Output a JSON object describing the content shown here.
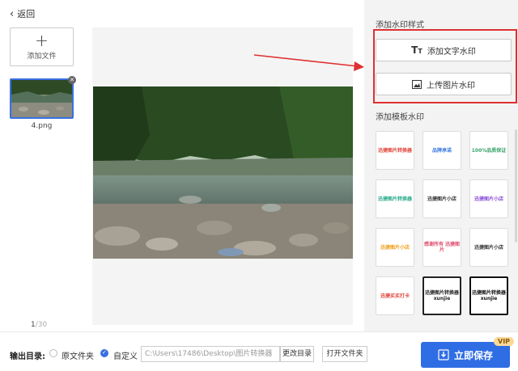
{
  "header": {
    "back_label": "返回"
  },
  "files": {
    "add_label": "添加文件",
    "items": [
      {
        "name": "4.png"
      }
    ],
    "page_current": "1",
    "page_total": "/30"
  },
  "panel": {
    "style_title": "添加水印样式",
    "text_watermark_label": "添加文字水印",
    "image_watermark_label": "上传图片水印",
    "template_title": "添加模板水印",
    "templates": [
      {
        "text": "迅捷图片转换器",
        "color": "#e0443a"
      },
      {
        "text": "品牌承诺",
        "color": "#3a7be0"
      },
      {
        "text": "100%品质保证",
        "color": "#39a36b"
      },
      {
        "text": "迅捷图片转换器",
        "color": "#27a98a"
      },
      {
        "text": "迅捷图片小店",
        "color": "#333333"
      },
      {
        "text": "迅捷图片小店",
        "color": "#8a4fd6"
      },
      {
        "text": "迅捷图片小店",
        "color": "#f0a020"
      },
      {
        "text": "感谢所有 迅捷图片",
        "color": "#e05070"
      },
      {
        "text": "迅捷图片小店",
        "color": "#333333"
      },
      {
        "text": "迅捷买买打卡",
        "color": "#e0443a"
      },
      {
        "text": "迅捷图片转换器 xunjie",
        "color": "#222222"
      },
      {
        "text": "迅捷图片转换器 xunjie",
        "color": "#111111"
      }
    ]
  },
  "output": {
    "label": "输出目录:",
    "option_original": "原文件夹",
    "option_custom": "自定义",
    "path": "C:\\Users\\17486\\Desktop\\图片转换器",
    "change_dir_label": "更改目录",
    "open_folder_label": "打开文件夹",
    "save_label": "立即保存",
    "vip_badge": "VIP"
  },
  "colors": {
    "accent": "#2f6de4",
    "highlight": "#e03030"
  }
}
